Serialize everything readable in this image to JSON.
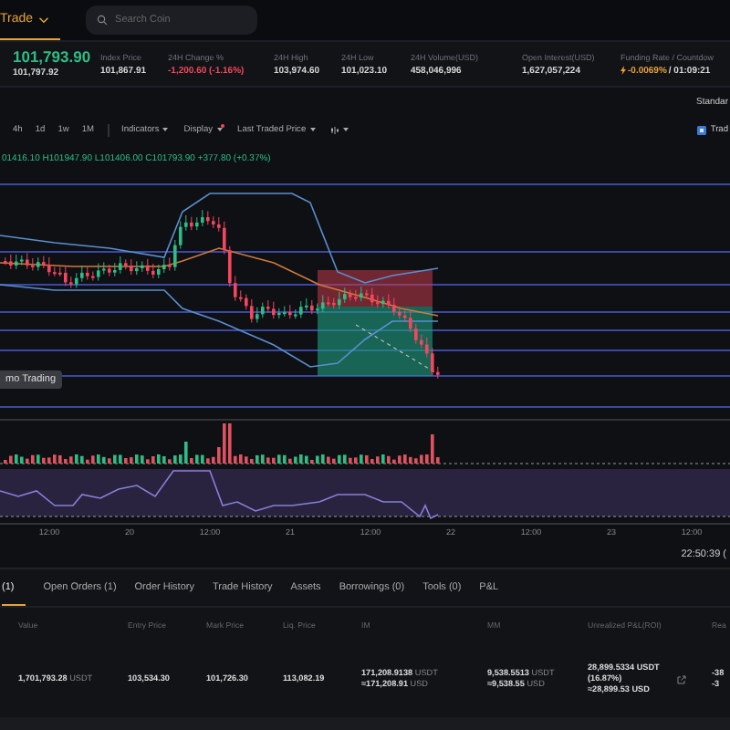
{
  "header": {
    "menu": "Trade",
    "search": {
      "placeholder": "Search Coin"
    }
  },
  "ticker": {
    "last_price": "101,793.90",
    "mark_price": "101,797.92",
    "stats": [
      {
        "label": "Index Price",
        "value": "101,867.91",
        "kind": "plain"
      },
      {
        "label": "24H Change %",
        "value": "-1,200.60 (-1.16%)",
        "kind": "down"
      },
      {
        "label": "24H High",
        "value": "103,974.60",
        "kind": "plain"
      },
      {
        "label": "24H Low",
        "value": "101,023.10",
        "kind": "plain"
      },
      {
        "label": "24H Volume(USD)",
        "value": "458,046,996",
        "kind": "plain"
      },
      {
        "label": "Open Interest(USD)",
        "value": "1,627,057,224",
        "kind": "plain"
      },
      {
        "label": "Funding Rate / Countdow",
        "value": "-0.0069%",
        "extra": "/ 01:09:21",
        "kind": "funding"
      }
    ]
  },
  "chart_view": {
    "mode": "Standar"
  },
  "toolbar": {
    "intervals": [
      "4h",
      "1d",
      "1w",
      "1M"
    ],
    "menus": [
      {
        "label": "Indicators",
        "alert": false
      },
      {
        "label": "Display",
        "alert": true
      },
      {
        "label": "Last Traded Price",
        "alert": false
      }
    ],
    "trade_button": "Trad"
  },
  "chart": {
    "ohlc": "01416.10 H101947.90 L101406.00 C101793.90 +377.80 (+0.37%)",
    "badge": "mo Trading",
    "x_labels": [
      "12:00",
      "20",
      "12:00",
      "21",
      "12:00",
      "22",
      "12:00",
      "23",
      "12:00"
    ],
    "clock": "22:50:39 ("
  },
  "tabs": [
    {
      "label": "(1)",
      "selected": true
    },
    {
      "label": "Open Orders (1)",
      "selected": false
    },
    {
      "label": "Order History",
      "selected": false
    },
    {
      "label": "Trade History",
      "selected": false
    },
    {
      "label": "Assets",
      "selected": false
    },
    {
      "label": "Borrowings (0)",
      "selected": false
    },
    {
      "label": "Tools (0)",
      "selected": false
    },
    {
      "label": "P&L",
      "selected": false
    }
  ],
  "positions": {
    "columns": [
      "Value",
      "Entry Price",
      "Mark Price",
      "Liq. Price",
      "IM",
      "MM",
      "Unrealized P&L(ROI)",
      "Rea"
    ],
    "row": {
      "value": "1,701,793.28",
      "value_unit": "USDT",
      "entry": "103,534.30",
      "mark": "101,726.30",
      "liq": "113,082.19",
      "im": "171,208.9138",
      "im_unit": "USDT",
      "im_usd": "≈171,208.91",
      "im_usd_unit": "USD",
      "mm": "9,538.5513",
      "mm_unit": "USDT",
      "mm_usd": "≈9,538.55",
      "mm_usd_unit": "USD",
      "pnl": "28,899.5334 USDT",
      "pnl_roi": "(16.87%)",
      "pnl_usd": "≈28,899.53 USD",
      "realized": "-38",
      "realized_2": "-3"
    }
  }
}
